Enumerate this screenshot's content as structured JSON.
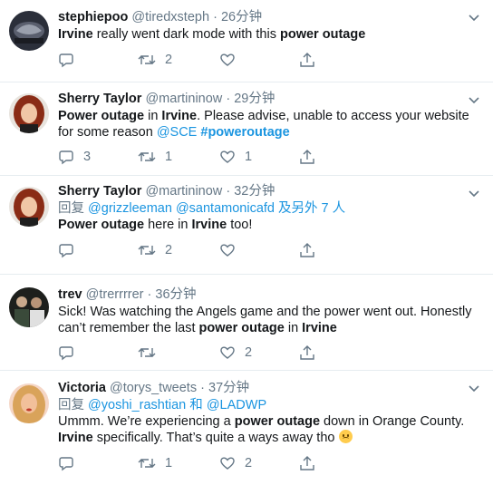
{
  "tweets": [
    {
      "name": "stephiepoo",
      "handle": "@tiredxsteph",
      "dot": "·",
      "time": "26分钟",
      "body": [
        {
          "t": "Irvine",
          "s": "b"
        },
        {
          "t": " really went dark mode with this ",
          "s": ""
        },
        {
          "t": "power outage",
          "s": "b"
        }
      ],
      "actions": {
        "reply": "",
        "retweet": "2",
        "like": "",
        "share": ""
      },
      "avatar": "avatar-dark"
    },
    {
      "name": "Sherry Taylor",
      "handle": "@martininow",
      "dot": "·",
      "time": "29分钟",
      "body": [
        {
          "t": "Power outage",
          "s": "b"
        },
        {
          "t": " in ",
          "s": ""
        },
        {
          "t": "Irvine",
          "s": "b"
        },
        {
          "t": ". Please advise, unable to access your website for some reason ",
          "s": ""
        },
        {
          "t": "@SCE",
          "s": "link"
        },
        {
          "t": " ",
          "s": ""
        },
        {
          "t": "#poweroutage",
          "s": "hashtag"
        }
      ],
      "actions": {
        "reply": "3",
        "retweet": "1",
        "like": "1",
        "share": ""
      },
      "avatar": "avatar-redhair"
    },
    {
      "name": "Sherry Taylor",
      "handle": "@martininow",
      "dot": "·",
      "time": "32分钟",
      "reply_to": [
        {
          "t": "回复 ",
          "s": ""
        },
        {
          "t": "@grizzleeman",
          "s": "link"
        },
        {
          "t": " ",
          "s": ""
        },
        {
          "t": "@santamonicafd",
          "s": "link"
        },
        {
          "t": " 及另外 7 人",
          "s": "link"
        }
      ],
      "body": [
        {
          "t": "Power outage",
          "s": "b"
        },
        {
          "t": " here in ",
          "s": ""
        },
        {
          "t": "Irvine",
          "s": "b"
        },
        {
          "t": " too!",
          "s": ""
        }
      ],
      "actions": {
        "reply": "",
        "retweet": "2",
        "like": "",
        "share": ""
      },
      "avatar": "avatar-redhair"
    },
    {
      "name": "trev",
      "handle": "@trerrrrer",
      "dot": "·",
      "time": "36分钟",
      "body": [
        {
          "t": "Sick! Was watching the Angels game and the power went out. Honestly can’t remember the last ",
          "s": ""
        },
        {
          "t": "power outage",
          "s": "b"
        },
        {
          "t": " in ",
          "s": ""
        },
        {
          "t": "Irvine",
          "s": "b"
        }
      ],
      "actions": {
        "reply": "",
        "retweet": "",
        "like": "2",
        "share": ""
      },
      "avatar": "avatar-group"
    },
    {
      "name": "Victoria",
      "handle": "@torys_tweets",
      "dot": "·",
      "time": "37分钟",
      "reply_to": [
        {
          "t": "回复 ",
          "s": ""
        },
        {
          "t": "@yoshi_rashtian",
          "s": "link"
        },
        {
          "t": " 和 ",
          "s": "link"
        },
        {
          "t": "@LADWP",
          "s": "link"
        }
      ],
      "body": [
        {
          "t": "Ummm. We’re experiencing a ",
          "s": ""
        },
        {
          "t": "power outage",
          "s": "b"
        },
        {
          "t": " down in Orange County. ",
          "s": ""
        },
        {
          "t": "Irvine",
          "s": "b"
        },
        {
          "t": " specifically. That’s quite a ways away tho ",
          "s": ""
        },
        {
          "t": "",
          "s": "emoji"
        }
      ],
      "actions": {
        "reply": "",
        "retweet": "1",
        "like": "2",
        "share": ""
      },
      "avatar": "avatar-blonde"
    }
  ],
  "icons": {
    "reply": "reply-icon",
    "retweet": "retweet-icon",
    "like": "like-icon",
    "share": "share-icon",
    "caret": "chevron-down-icon",
    "emoji": "worried-face-emoji"
  },
  "colors": {
    "text": "#14171a",
    "muted": "#657786",
    "link": "#1b95e0",
    "divider": "#e6ecf0"
  }
}
